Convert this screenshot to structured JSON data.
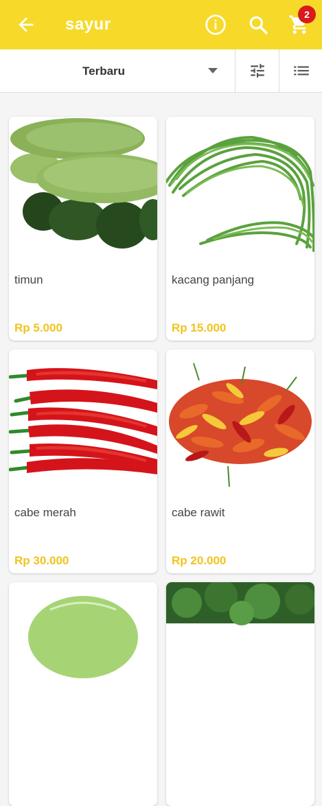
{
  "appbar": {
    "title": "sayur",
    "cart_count": "2",
    "color": "#f7d92a"
  },
  "toolbar": {
    "sort_label": "Terbaru",
    "icons": [
      "tune-icon",
      "list-view-icon"
    ]
  },
  "products": [
    {
      "name": "timun",
      "price": "Rp 5.000"
    },
    {
      "name": "kacang panjang",
      "price": "Rp 15.000"
    },
    {
      "name": "cabe merah",
      "price": "Rp 30.000"
    },
    {
      "name": "cabe rawit",
      "price": "Rp 20.000"
    },
    {
      "name": "",
      "price": ""
    },
    {
      "name": "",
      "price": ""
    }
  ],
  "colors": {
    "price": "#f0c41b",
    "badge": "#d71a1a"
  }
}
